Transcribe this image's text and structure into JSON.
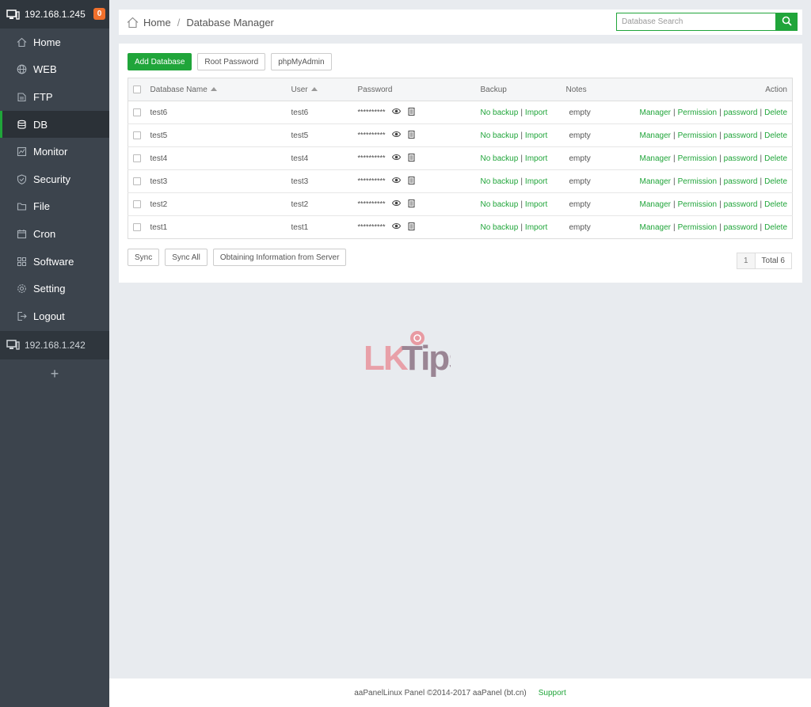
{
  "sidebar": {
    "server_ip": "192.168.1.245",
    "alert_count": "0",
    "items": [
      {
        "label": "Home",
        "icon": "home-icon"
      },
      {
        "label": "WEB",
        "icon": "globe-icon"
      },
      {
        "label": "FTP",
        "icon": "ftp-icon"
      },
      {
        "label": "DB",
        "icon": "database-icon",
        "active": true
      },
      {
        "label": "Monitor",
        "icon": "monitor-icon"
      },
      {
        "label": "Security",
        "icon": "shield-icon"
      },
      {
        "label": "File",
        "icon": "folder-icon"
      },
      {
        "label": "Cron",
        "icon": "calendar-icon"
      },
      {
        "label": "Software",
        "icon": "grid-icon"
      },
      {
        "label": "Setting",
        "icon": "gear-icon"
      },
      {
        "label": "Logout",
        "icon": "logout-icon"
      }
    ],
    "other_server_ip": "192.168.1.242",
    "add_label": "+"
  },
  "header": {
    "crumb_home": "Home",
    "crumb_sep": "/",
    "crumb_current": "Database Manager",
    "search_placeholder": "Database Search"
  },
  "toolbar": {
    "add_label": "Add Database",
    "root_label": "Root Password",
    "pma_label": "phpMyAdmin"
  },
  "table": {
    "headers": {
      "name": "Database Name",
      "user": "User",
      "password": "Password",
      "backup": "Backup",
      "notes": "Notes",
      "action": "Action"
    },
    "rows": [
      {
        "name": "test6",
        "user": "test6",
        "password": "**********",
        "backup": "No backup",
        "import": "Import",
        "notes": "empty"
      },
      {
        "name": "test5",
        "user": "test5",
        "password": "**********",
        "backup": "No backup",
        "import": "Import",
        "notes": "empty"
      },
      {
        "name": "test4",
        "user": "test4",
        "password": "**********",
        "backup": "No backup",
        "import": "Import",
        "notes": "empty"
      },
      {
        "name": "test3",
        "user": "test3",
        "password": "**********",
        "backup": "No backup",
        "import": "Import",
        "notes": "empty"
      },
      {
        "name": "test2",
        "user": "test2",
        "password": "**********",
        "backup": "No backup",
        "import": "Import",
        "notes": "empty"
      },
      {
        "name": "test1",
        "user": "test1",
        "password": "**********",
        "backup": "No backup",
        "import": "Import",
        "notes": "empty"
      }
    ],
    "actions": {
      "manager": "Manager",
      "permission": "Permission",
      "password": "password",
      "delete": "Delete",
      "sep": "|"
    }
  },
  "bottom": {
    "sync_label": "Sync",
    "sync_all_label": "Sync All",
    "obtain_label": "Obtaining Information from Server",
    "page": "1",
    "total": "Total 6"
  },
  "watermark": {
    "text": "LKTips"
  },
  "footer": {
    "copyright": "aaPanelLinux Panel ©2014-2017 aaPanel (bt.cn)",
    "support": "Support"
  },
  "colors": {
    "accent": "#20a53a",
    "sidebar_bg": "#3c444d",
    "badge": "#f0702c"
  }
}
